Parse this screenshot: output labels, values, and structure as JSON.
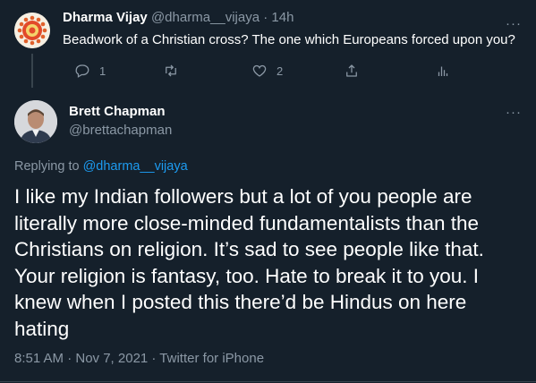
{
  "reply_tweet": {
    "display_name": "Dharma Vijay",
    "handle": "@dharma__vijaya",
    "separator": "·",
    "time": "14h",
    "text": "Beadwork of a Christian cross? The one which Europeans forced upon you?",
    "actions": {
      "reply_count": "1",
      "retweet_count": "",
      "like_count": "2"
    },
    "more": "···"
  },
  "main_tweet": {
    "display_name": "Brett Chapman",
    "handle": "@brettachapman",
    "more": "···",
    "replying_prefix": "Replying to",
    "replying_to": "@dharma__vijaya",
    "text": "I like my Indian followers but a lot of you people are literally more close-minded fundamentalists than the Christians on religion. It’s sad to see people like that. Your religion is fantasy, too. Hate to break it to you. I knew when I posted this there’d be Hindus on here hating",
    "meta": "8:51 AM · Nov 7, 2021 · Twitter for iPhone"
  },
  "colors": {
    "background": "#15202b",
    "text": "#ffffff",
    "muted": "#8b98a5",
    "link": "#1d9bf0",
    "divider": "#38444d"
  }
}
